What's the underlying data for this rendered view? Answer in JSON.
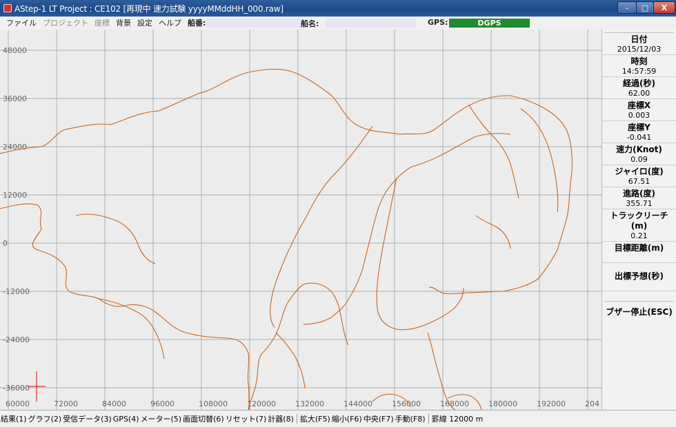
{
  "window": {
    "title": "AStep-1 LT  Project : CE102  [再現中 速力試験 yyyyMMddHH_000.raw]",
    "controls": {
      "minimize": "–",
      "maximize": "□",
      "close": "X"
    }
  },
  "menu": {
    "items": [
      "ファイル",
      "プロジェクト",
      "座標",
      "背景",
      "設定",
      "ヘルプ"
    ],
    "disabled": [
      "プロジェクト",
      "座標"
    ],
    "ship_no_label": "船番:",
    "ship_name_label": "船名:",
    "gps_label": "GPS:",
    "gps_status": "DGPS",
    "gps_color": "#1f8a2e"
  },
  "map": {
    "y_ticks": [
      "48000",
      "36000",
      "24000",
      "12000",
      "0",
      "-12000",
      "-24000",
      "-36000"
    ],
    "x_ticks": [
      "60000",
      "72000",
      "84000",
      "96000",
      "108000",
      "120000",
      "132000",
      "144000",
      "156000",
      "168000",
      "180000",
      "192000",
      "204"
    ],
    "line_color": "#c8641e",
    "marker_color": "#e03030",
    "grid_color": "#999999"
  },
  "panel": {
    "fields": [
      {
        "label": "日付",
        "value": "2015/12/03"
      },
      {
        "label": "時刻",
        "value": "14:57:59"
      },
      {
        "label": "経過(秒)",
        "value": "62.00"
      },
      {
        "label": "座標X",
        "value": "0.003"
      },
      {
        "label": "座標Y",
        "value": "-0.041"
      },
      {
        "label": "速力(Knot)",
        "value": "0.09"
      },
      {
        "label": "ジャイロ(度)",
        "value": "67.51"
      },
      {
        "label": "進路(度)",
        "value": "355.71"
      },
      {
        "label": "トラックリーチ(m)",
        "value": "0.21"
      },
      {
        "label": "目標距離(m)",
        "value": ""
      },
      {
        "label": "出標予想(秒)",
        "value": ""
      }
    ],
    "buzzer_label": "ブザー停止(ESC)"
  },
  "status": {
    "keys": [
      "結果(1)",
      "グラフ(2)",
      "受信データ(3)",
      "GPS(4)",
      "メーター(5)",
      "画面切替(6)",
      "リセット(7)",
      "計器(8)"
    ],
    "view_keys": [
      "拡大(F5)",
      "縮小(F6)",
      "中央(F7)",
      "手動(F8)"
    ],
    "grid_text": "罫線  12000  m"
  }
}
